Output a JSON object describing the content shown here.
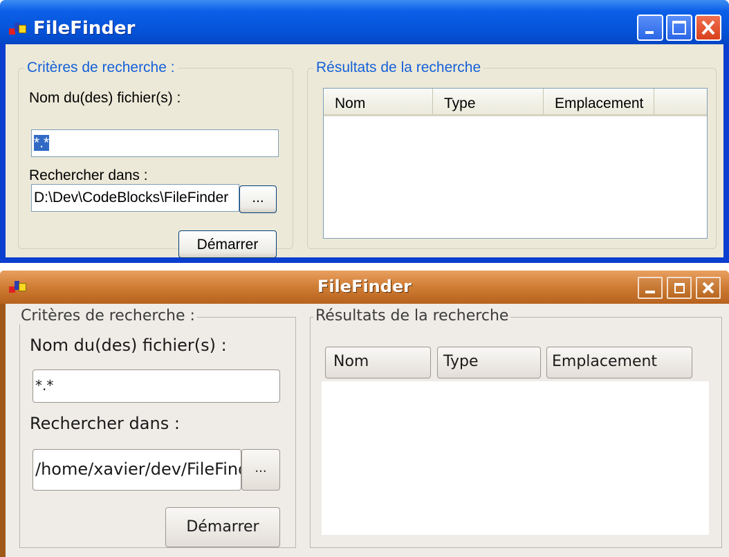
{
  "xp_window": {
    "title": "FileFinder",
    "criteria_group": "Critères de recherche :",
    "filename_label": "Nom du(des) fichier(s) :",
    "filename_value": "*.*",
    "search_in_label": "Rechercher dans :",
    "search_in_value": "D:\\Dev\\CodeBlocks\\FileFinder",
    "browse_label": "...",
    "start_label": "Démarrer",
    "results_group": "Résultats de la recherche",
    "columns": [
      "Nom",
      "Type",
      "Emplacement"
    ]
  },
  "gtk_window": {
    "title": "FileFinder",
    "criteria_group": "Critères de recherche :",
    "filename_label": "Nom du(des) fichier(s) :",
    "filename_value": "*.*",
    "search_in_label": "Rechercher dans :",
    "search_in_value": "/home/xavier/dev/FileFinder",
    "browse_label": "...",
    "start_label": "Démarrer",
    "results_group": "Résultats de la recherche",
    "columns": [
      "Nom",
      "Type",
      "Emplacement"
    ]
  },
  "colors": {
    "xp_title_blue": "#0553d8",
    "xp_close_red": "#d8401c",
    "xp_group_text": "#1560d8",
    "xp_selection": "#316ac5",
    "gtk_title_orange": "#cf7c34",
    "dialog_face_xp": "#ece9d8",
    "dialog_face_gtk": "#efebe7"
  },
  "icons": {
    "app_icon": "filefinder-app-icon",
    "minimize": "minimize-icon",
    "maximize": "maximize-icon",
    "close": "close-icon"
  }
}
